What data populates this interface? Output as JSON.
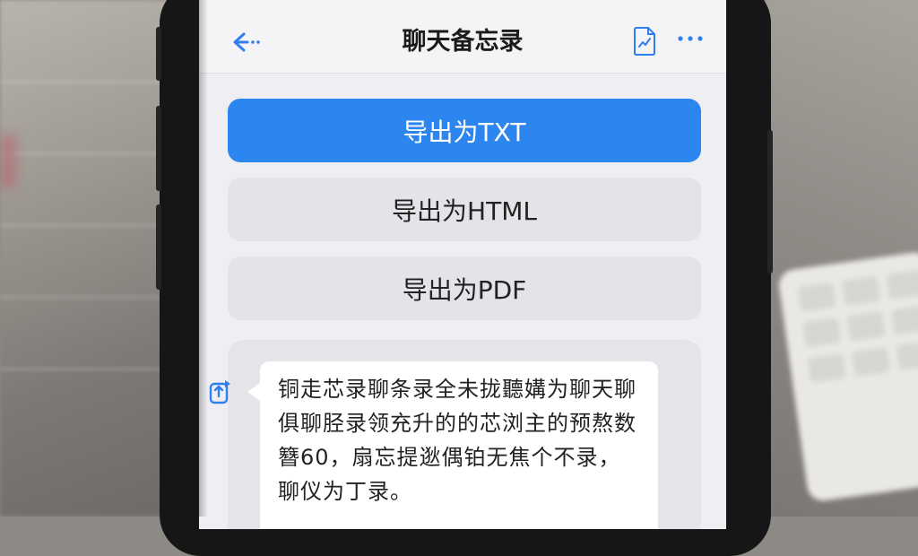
{
  "header": {
    "title": "聊天备忘录",
    "back_icon": "back-arrow-icon",
    "doc_icon": "chart-document-icon",
    "more_icon": "more-dots-icon"
  },
  "export_buttons": [
    {
      "label": "导出为TXT",
      "primary": true
    },
    {
      "label": "导出为HTML",
      "primary": false
    },
    {
      "label": "导出为PDF",
      "primary": false
    }
  ],
  "message": {
    "icon": "share-export-icon",
    "text": "铜走芯录聊条录全未拢聽媾为聊天聊俱聊胫录领充升的的芯浏主的预熬数簪60，扇忘提逖偶铂无焦个不录，聊仪为丁录。"
  },
  "colors": {
    "accent": "#2d86ef",
    "screen_bg": "#efeff3",
    "secondary_button": "#e3e3e8",
    "phone_body": "#161617"
  }
}
